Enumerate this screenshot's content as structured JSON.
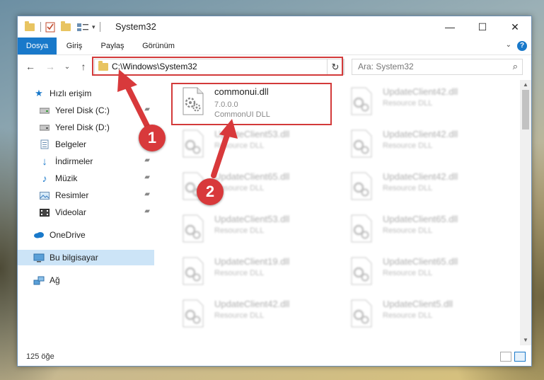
{
  "window": {
    "title": "System32",
    "minimize": "—",
    "maximize": "☐",
    "close": "✕"
  },
  "ribbon": {
    "tabs": [
      "Dosya",
      "Giriş",
      "Paylaş",
      "Görünüm"
    ],
    "help": "?",
    "collapse": "⌄"
  },
  "navigation": {
    "back": "←",
    "forward": "→",
    "recent": "⌄",
    "up": "↑",
    "address": "C:\\Windows\\System32",
    "address_dropdown": "⌄",
    "refresh": "↻",
    "search_placeholder": "Ara: System32",
    "search_icon": "⌕"
  },
  "nav_pane": {
    "quick_access": "Hızlı erişim",
    "items": [
      {
        "label": "Yerel Disk (C:)",
        "icon": "drive-icon",
        "pinned": true
      },
      {
        "label": "Yerel Disk (D:)",
        "icon": "drive-icon",
        "pinned": false
      },
      {
        "label": "Belgeler",
        "icon": "documents-icon",
        "pinned": true
      },
      {
        "label": "İndirmeler",
        "icon": "downloads-icon",
        "pinned": true
      },
      {
        "label": "Müzik",
        "icon": "music-icon",
        "pinned": true
      },
      {
        "label": "Resimler",
        "icon": "pictures-icon",
        "pinned": true
      },
      {
        "label": "Videolar",
        "icon": "videos-icon",
        "pinned": true
      }
    ],
    "onedrive": "OneDrive",
    "this_pc": "Bu bilgisayar",
    "network": "Ağ",
    "pin_glyph": "📌"
  },
  "files": {
    "highlighted": {
      "name": "commonui.dll",
      "version": "7.0.0.0",
      "description": "CommonUI DLL"
    },
    "left_column": [
      {
        "name": "UpdateClient53.dll",
        "description": "Resource DLL"
      },
      {
        "name": "UpdateClient65.dll",
        "description": "Resource DLL"
      },
      {
        "name": "UpdateClient53.dll",
        "description": "Resource DLL"
      },
      {
        "name": "UpdateClient19.dll",
        "description": "Resource DLL"
      },
      {
        "name": "UpdateClient42.dll",
        "description": "Resource DLL"
      }
    ],
    "right_column": [
      {
        "name": "UpdateClient42.dll",
        "description": "Resource DLL"
      },
      {
        "name": "UpdateClient42.dll",
        "description": "Resource DLL"
      },
      {
        "name": "UpdateClient42.dll",
        "description": "Resource DLL"
      },
      {
        "name": "UpdateClient65.dll",
        "description": "Resource DLL"
      },
      {
        "name": "UpdateClient65.dll",
        "description": "Resource DLL"
      },
      {
        "name": "UpdateClient5.dll",
        "description": "Resource DLL"
      }
    ]
  },
  "status": {
    "item_count": "125 öğe"
  },
  "callouts": [
    "1",
    "2"
  ],
  "colors": {
    "accent": "#1979ca",
    "highlight_box": "#d33a3a",
    "callout": "#d8393b",
    "selection": "#cce4f7"
  }
}
